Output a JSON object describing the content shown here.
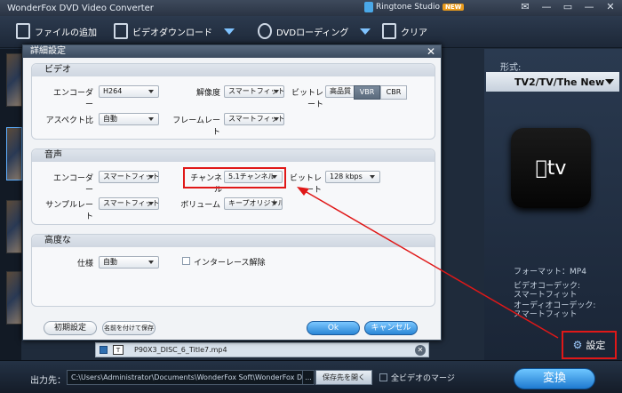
{
  "app": {
    "title": "WonderFox DVD Video Converter",
    "ringtone_studio": "Ringtone Studio",
    "new_badge": "NEW",
    "window_buttons": [
      "✉",
      "—",
      "▭",
      "—",
      "✕"
    ]
  },
  "toolbar": {
    "add_files": "ファイルの追加",
    "video_download": "ビデオダウンロード",
    "dvd_loading": "DVDローディング",
    "clear": "クリア"
  },
  "right_panel": {
    "format_label": "形式:",
    "format_value": "TV2/TV/The New",
    "device_logo": "tv",
    "format_info": "フォーマット：MP4",
    "video_codec_label": "ビデオコーデック:",
    "video_codec_value": "スマートフィット",
    "audio_codec_label": "オーディオコーデック:",
    "audio_codec_value": "スマートフィット",
    "settings_button": "設定"
  },
  "file_row": {
    "type_icon": "T",
    "file_name": "P90X3_DISC_6_Title7.mp4"
  },
  "bottom": {
    "output_label": "出力先：",
    "output_path": "C:\\Users\\Administrator\\Documents\\WonderFox Soft\\WonderFox DVD Vi...",
    "path_more": "...",
    "open_folder": "保存先を開く",
    "merge_all": "全ビデオのマージ",
    "convert": "変換"
  },
  "dialog": {
    "title": "詳細設定",
    "close": "✕",
    "video": {
      "header": "ビデオ",
      "encoder_label": "エンコーダー",
      "encoder_value": "H264",
      "resolution_label": "解像度",
      "resolution_value": "スマートフィット",
      "bitrate_label": "ビットレート",
      "bitrate_value": "高品質",
      "vbr": "VBR",
      "cbr": "CBR",
      "aspect_label": "アスペクト比",
      "aspect_value": "自動",
      "framerate_label": "フレームレート",
      "framerate_value": "スマートフィット"
    },
    "audio": {
      "header": "音声",
      "encoder_label": "エンコーダー",
      "encoder_value": "スマートフィット",
      "channel_label": "チャンネル",
      "channel_value": "5.1チャンネル",
      "bitrate_label": "ビットレート",
      "bitrate_value": "128 kbps",
      "samplerate_label": "サンプルレート",
      "samplerate_value": "スマートフィット",
      "volume_label": "ボリューム",
      "volume_value": "キープオリジナル"
    },
    "advanced": {
      "header": "高度な",
      "spec_label": "仕様",
      "spec_value": "自動",
      "deinterlace_label": "インターレース解除"
    },
    "buttons": {
      "reset": "初期設定",
      "save_as": "名前を付けて保存",
      "ok": "Ok",
      "cancel": "キャンセル"
    }
  }
}
